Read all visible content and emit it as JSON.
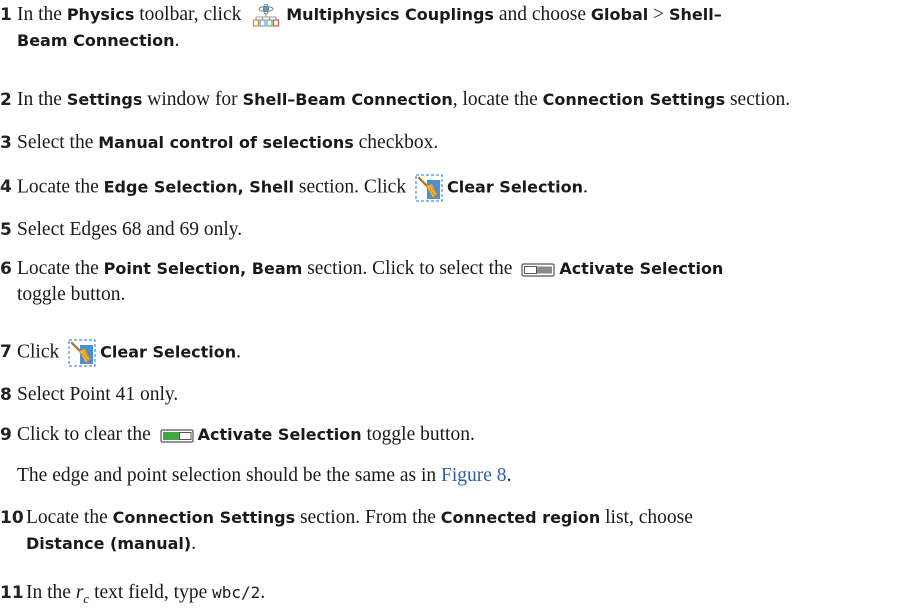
{
  "steps": [
    {
      "num": "1",
      "t1": "In the ",
      "b1": "Physics",
      "t2": " toolbar, click ",
      "b2": "Multiphysics Couplings",
      "t3": " and choose ",
      "b3": "Global",
      "t4": " > ",
      "b4": "Shell–",
      "b5": "Beam Connection",
      "t5": "."
    },
    {
      "num": "2",
      "t1": "In the ",
      "b1": "Settings",
      "t2": " window for ",
      "b2": "Shell–Beam Connection",
      "t3": ", locate the ",
      "b3": "Connection Settings",
      "t4": " section."
    },
    {
      "num": "3",
      "t1": "Select the ",
      "b1": "Manual control of selections",
      "t2": " checkbox."
    },
    {
      "num": "4",
      "t1": "Locate the ",
      "b1": "Edge Selection, Shell",
      "t2": " section. Click ",
      "b2": "Clear Selection",
      "t3": "."
    },
    {
      "num": "5",
      "t1": "Select Edges 68 and 69 only."
    },
    {
      "num": "6",
      "t1": "Locate the ",
      "b1": "Point Selection, Beam",
      "t2": " section. Click to select the ",
      "b2": "Activate Selection",
      "t3": "toggle button."
    },
    {
      "num": "7",
      "t1": "Click ",
      "b1": "Clear Selection",
      "t2": "."
    },
    {
      "num": "8",
      "t1": "Select Point 41 only."
    },
    {
      "num": "9",
      "t1": "Click to clear the ",
      "b1": "Activate Selection",
      "t2": " toggle button."
    },
    {
      "num": "10",
      "t1": "Locate the ",
      "b1": "Connection Settings",
      "t2": " section. From the ",
      "b2": "Connected region",
      "t3": " list, choose ",
      "b3": "Distance (manual)",
      "t4": "."
    },
    {
      "num": "11",
      "t1": "In the ",
      "m1": "r",
      "m2": "c",
      "t2": " text field, type ",
      "code": "wbc/2",
      "t3": "."
    }
  ],
  "note": {
    "t1": "The edge and point selection should be the same as in ",
    "link": "Figure 8",
    "t2": "."
  }
}
